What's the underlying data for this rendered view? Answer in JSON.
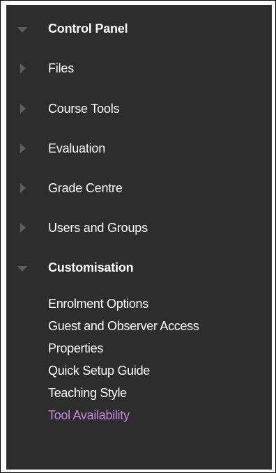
{
  "menu": {
    "items": [
      {
        "label": "Control Panel",
        "expanded": true,
        "icon": "triangle-down-icon"
      },
      {
        "label": "Files",
        "expanded": false,
        "icon": "triangle-right-icon"
      },
      {
        "label": "Course Tools",
        "expanded": false,
        "icon": "triangle-right-icon"
      },
      {
        "label": "Evaluation",
        "expanded": false,
        "icon": "triangle-right-icon"
      },
      {
        "label": "Grade Centre",
        "expanded": false,
        "icon": "triangle-right-icon"
      },
      {
        "label": "Users and Groups",
        "expanded": false,
        "icon": "triangle-right-icon"
      },
      {
        "label": "Customisation",
        "expanded": true,
        "icon": "triangle-down-icon"
      }
    ],
    "customisation_subitems": [
      {
        "label": "Enrolment Options"
      },
      {
        "label": "Guest and Observer Access"
      },
      {
        "label": "Properties"
      },
      {
        "label": "Quick Setup Guide"
      },
      {
        "label": "Teaching Style"
      },
      {
        "label": "Tool Availability",
        "active": true
      }
    ]
  },
  "colors": {
    "panel_background": "#2d2d2d",
    "text": "#ffffff",
    "arrow": "#5e5e5e",
    "active_link": "#c586e0"
  }
}
